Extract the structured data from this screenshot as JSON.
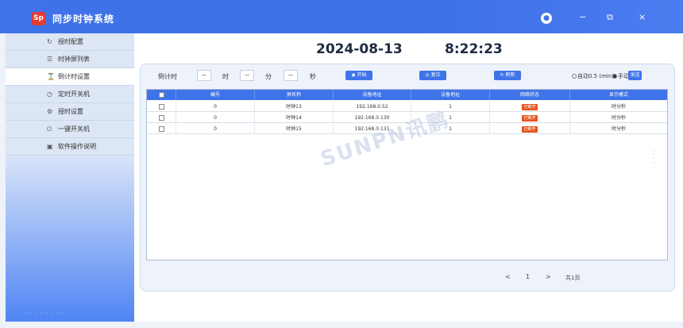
{
  "app": {
    "title": "同步时钟系统",
    "logo_text": "Sp",
    "colors": {
      "accent": "#3f73e9",
      "status": "#e8541c"
    }
  },
  "window": {
    "user_icon": "user-icon",
    "minimize": "−",
    "restore": "⧉",
    "close": "×"
  },
  "sidebar": {
    "items": [
      {
        "label": "授时配置",
        "icon": "sync-icon"
      },
      {
        "label": "时钟屏列表",
        "icon": "list-icon"
      },
      {
        "label": "倒计时设置",
        "icon": "hourglass-icon"
      },
      {
        "label": "定时开关机",
        "icon": "clock-icon"
      },
      {
        "label": "授时设置",
        "icon": "settings-icon"
      },
      {
        "label": "一键开关机",
        "icon": "power-icon"
      },
      {
        "label": "软件操作说明",
        "icon": "doc-icon"
      }
    ],
    "active_index": 2
  },
  "header": {
    "date": "2024-08-13",
    "time": "8:22:23"
  },
  "controls": {
    "countdown_label": "倒计时",
    "hour_value": "--",
    "hour_unit": "时",
    "minute_value": "--",
    "minute_unit": "分",
    "second_value": "--",
    "second_unit": "秒",
    "start_label": "开始",
    "reset_label": "复位",
    "refresh_label": "刷新",
    "auto_label": "自动",
    "auto_value": "0.5",
    "auto_unit": "(min)",
    "manual_label": "手动",
    "send_label": "发送"
  },
  "table": {
    "headers": [
      "",
      "编号",
      "屏名称",
      "设备地址",
      "设备地址",
      "网络状态",
      "显示模式"
    ],
    "rows": [
      {
        "id": "0",
        "name": "时钟13",
        "ip": "192.168.0.52",
        "addr": "1",
        "status": "已断开",
        "mode": "时分秒"
      },
      {
        "id": "0",
        "name": "时钟14",
        "ip": "192.168.0.130",
        "addr": "1",
        "status": "已断开",
        "mode": "时分秒"
      },
      {
        "id": "0",
        "name": "时钟15",
        "ip": "192.168.0.131",
        "addr": "1",
        "status": "已断开",
        "mode": "时分秒"
      }
    ]
  },
  "pager": {
    "prev": "<",
    "page": "1",
    "next": ">",
    "total": "共1页"
  },
  "watermark": "SUNPN讯鹏"
}
